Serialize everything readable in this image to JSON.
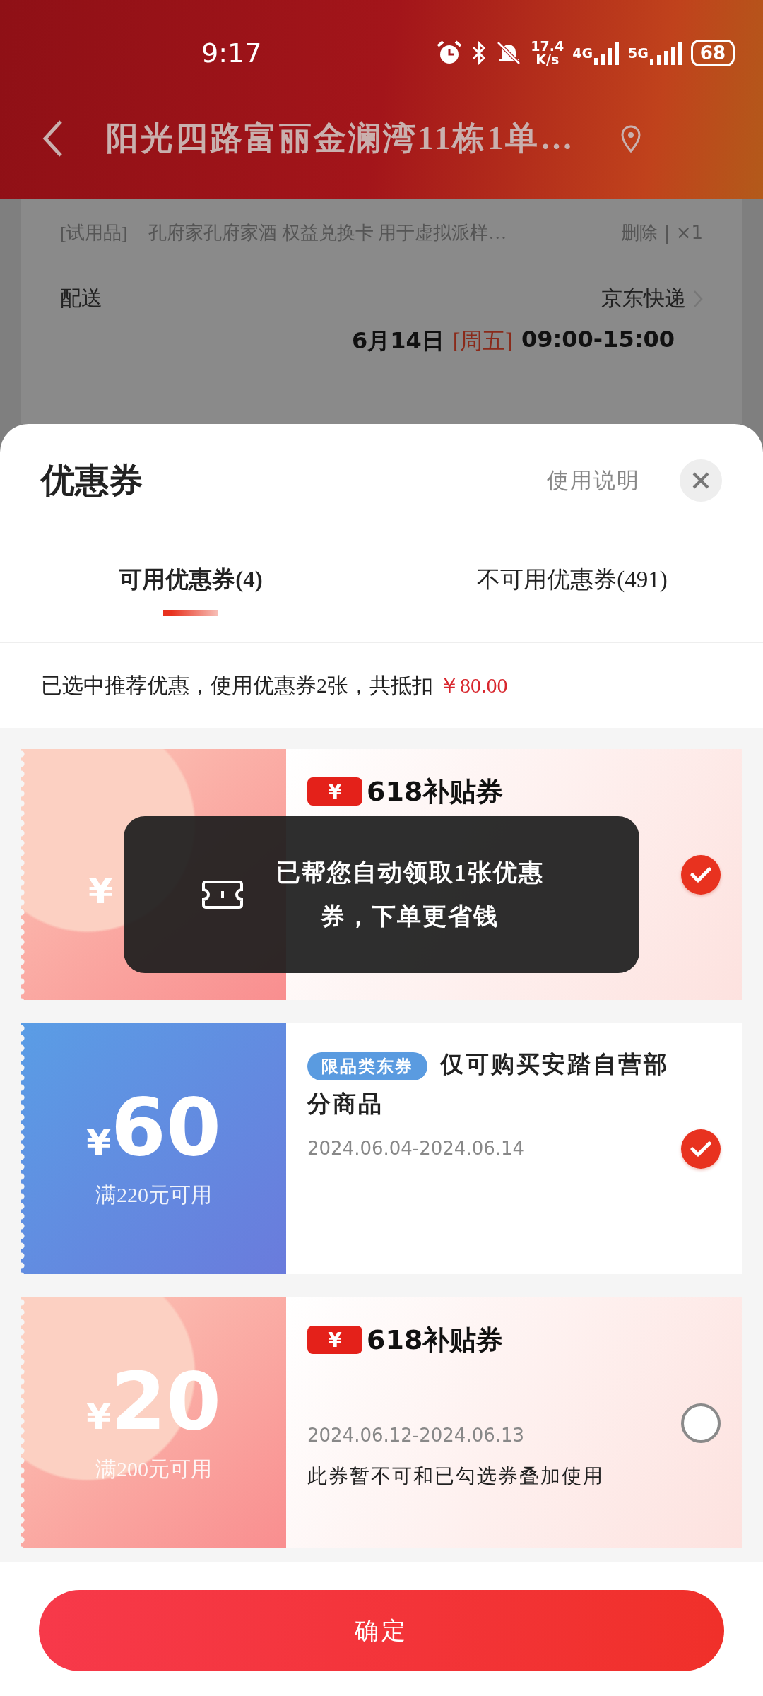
{
  "status_bar": {
    "time": "9:17",
    "net_speed": "17.4",
    "net_speed_unit": "K/s",
    "network_1": "4G",
    "network_2": "5G",
    "battery": "68"
  },
  "nav": {
    "title": "阳光四路富丽金澜湾11栋1单…"
  },
  "order": {
    "items": [
      {
        "tag": "[试用品]",
        "name": "孔府家孔府家酒 权益兑换卡 用于虚拟派样…",
        "action": "删除 | ×1"
      }
    ],
    "delivery": {
      "label": "配送",
      "carrier": "京东快递",
      "date": "6月14日",
      "weekday": "[周五]",
      "time": "09:00-15:00"
    }
  },
  "sheet": {
    "title": "优惠券",
    "help": "使用说明",
    "tabs": [
      {
        "label": "可用优惠券(4)",
        "selected": true
      },
      {
        "label": "不可用优惠券(491)",
        "selected": false
      }
    ],
    "summary": {
      "text": "已选中推荐优惠，使用优惠券2张，共抵扣",
      "amount": "￥80.00"
    },
    "coupons": [
      {
        "kind": "subsidy",
        "currency": "¥",
        "badge_symbol": "¥",
        "badge_label": "618补贴券",
        "selected": true
      },
      {
        "kind": "category",
        "currency": "¥",
        "amount": "60",
        "condition": "满220元可用",
        "tag": "限品类东券",
        "title": "仅可购买安踏自营部分商品",
        "date": "2024.06.04-2024.06.14",
        "selected": true
      },
      {
        "kind": "subsidy",
        "currency": "¥",
        "amount": "20",
        "condition": "满200元可用",
        "badge_symbol": "¥",
        "badge_label": "618补贴券",
        "date": "2024.06.12-2024.06.13",
        "note": "此券暂不可和已勾选券叠加使用",
        "selected": false
      }
    ],
    "confirm": "确定"
  },
  "toast": {
    "text": "已帮您自动领取1张优惠券，下单更省钱"
  }
}
